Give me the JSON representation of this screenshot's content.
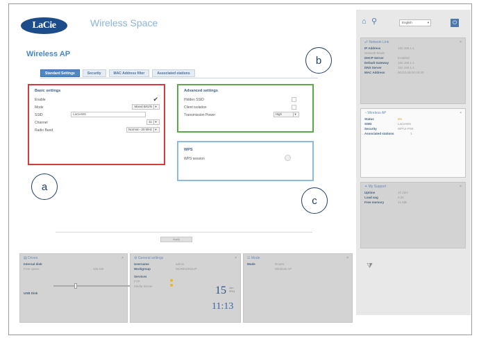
{
  "header": {
    "logo": "LaCie",
    "app_title": "Wireless Space"
  },
  "main": {
    "title": "Wireless AP",
    "tabs": [
      {
        "label": "Standard Settings"
      },
      {
        "label": "Security"
      },
      {
        "label": "MAC Address filter"
      },
      {
        "label": "Associated stations"
      }
    ],
    "basic": {
      "title": "Basic settings",
      "enable_label": "Enable",
      "mode_label": "Mode",
      "mode_value": "Mixed B/G/N",
      "ssid_label": "SSID",
      "ssid_value": "LaCieWS",
      "channel_label": "Channel",
      "channel_value": "11",
      "band_label": "Radio Band",
      "band_value": "Normal - 20 MHz"
    },
    "advanced": {
      "title": "Advanced settings",
      "hidden_label": "Hidden SSID",
      "isolation_label": "Client isolation",
      "power_label": "Transmission Power",
      "power_value": "High"
    },
    "wps": {
      "title": "WPS",
      "session_label": "WPS session"
    },
    "footer_button": "Apply"
  },
  "callouts": {
    "a": "a",
    "b": "b",
    "c": "c"
  },
  "sidebar": {
    "language": "English",
    "network": {
      "title": "Network Link",
      "rows": [
        {
          "k": "IP Address",
          "v": "192.168.1.1"
        },
        {
          "k": "Network Mode",
          "v": ""
        },
        {
          "k": "DHCP Server",
          "v": "Enabled"
        },
        {
          "k": "Default Gateway",
          "v": "192.168.1.1"
        },
        {
          "k": "DNS Server",
          "v": "192.168.1.1"
        },
        {
          "k": "MAC Address",
          "v": "00:D0:4B:00:00:00"
        }
      ]
    },
    "wireless": {
      "title": "Wireless AP",
      "rows": [
        {
          "k": "Status",
          "v": "On"
        },
        {
          "k": "SSID",
          "v": "LaCieWS"
        },
        {
          "k": "Security",
          "v": "WPA2-PSK"
        },
        {
          "k": "Associated stations",
          "v": "1"
        }
      ]
    },
    "support": {
      "title": "My Support",
      "rows": [
        {
          "k": "Uptime",
          "v": "1h 15m"
        },
        {
          "k": "Load avg",
          "v": "0.05"
        },
        {
          "k": "Free memory",
          "v": "21 MB"
        }
      ]
    }
  },
  "bottom": {
    "drives": {
      "title": "Drives",
      "internal_label": "Internal disk",
      "internal_sub": "Free space",
      "internal_val": "100 GB",
      "usb_label": "USB Disk"
    },
    "general": {
      "title": "General settings",
      "username_label": "Username",
      "workgroup_label": "Workgroup",
      "username_value": "admin",
      "workgroup_value": "WORKGROUP",
      "services_label": "Services",
      "svc1": "FTP",
      "svc2": "Media Server",
      "clock_day": "15",
      "clock_mon": "Jun 2011",
      "clock_time": "11:13"
    },
    "mode": {
      "title": "Mode",
      "label": "Mode",
      "value": "Router",
      "sub": "Wireless AP"
    }
  }
}
